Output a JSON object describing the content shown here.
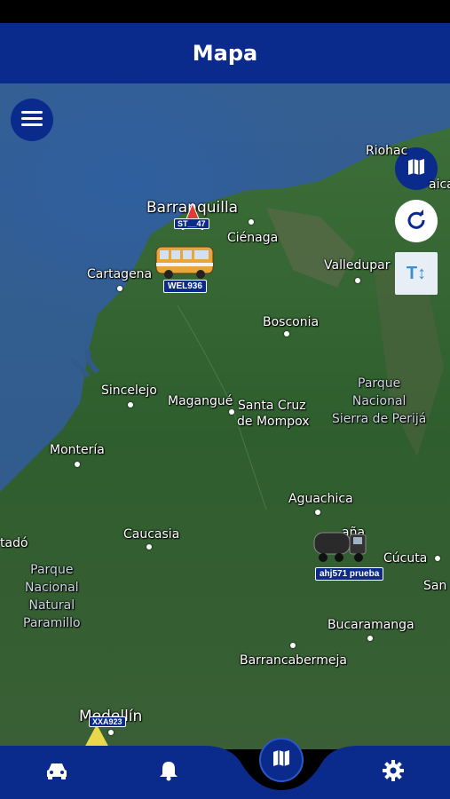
{
  "header": {
    "title": "Mapa"
  },
  "map": {
    "cities": [
      {
        "id": "barranquilla",
        "label": "Barranquilla",
        "big": true
      },
      {
        "id": "cienaga",
        "label": "Ciénaga"
      },
      {
        "id": "cartagena",
        "label": "Cartagena"
      },
      {
        "id": "valledupar",
        "label": "Valledupar"
      },
      {
        "id": "bosconia",
        "label": "Bosconia"
      },
      {
        "id": "sincelejo",
        "label": "Sincelejo"
      },
      {
        "id": "magangue",
        "label": "Magangué"
      },
      {
        "id": "santacruz1",
        "label": "Santa Cruz"
      },
      {
        "id": "santacruz2",
        "label": "de Mompox"
      },
      {
        "id": "monteria",
        "label": "Montería"
      },
      {
        "id": "aguachica",
        "label": "Aguachica"
      },
      {
        "id": "caucasia",
        "label": "Caucasia"
      },
      {
        "id": "cucuta",
        "label": "Cúcuta"
      },
      {
        "id": "bucaramanga",
        "label": "Bucaramanga"
      },
      {
        "id": "barrancabermeja",
        "label": "Barrancabermeja"
      },
      {
        "id": "medellin",
        "label": "Medellín",
        "big": true
      },
      {
        "id": "riohacha",
        "label": "Riohac"
      },
      {
        "id": "tado",
        "label": "tadó"
      },
      {
        "id": "san",
        "label": "San"
      },
      {
        "id": "ocana",
        "label": "aña"
      },
      {
        "id": "aica",
        "label": "aica"
      }
    ],
    "parks": [
      {
        "id": "perija",
        "lines": [
          "Parque",
          "Nacional",
          "Sierra de Perijá"
        ]
      },
      {
        "id": "paramillo",
        "lines": [
          "Parque",
          "Nacional",
          "Natural",
          "Paramillo"
        ]
      }
    ],
    "vehicles": [
      {
        "id": "bus",
        "plate": "WEL936",
        "icon": "bus-icon"
      },
      {
        "id": "arrow",
        "plate": "ST__47",
        "icon": "red-arrow-marker-icon"
      },
      {
        "id": "truck",
        "plate": "ahj571 prueba",
        "icon": "tanker-truck-icon"
      },
      {
        "id": "yellow",
        "plate": "XXA923",
        "icon": "yellow-arrow-marker-icon"
      }
    ],
    "controls": {
      "menu_icon": "hamburger-menu-icon",
      "layers_icon": "map-layers-icon",
      "refresh_icon": "refresh-icon",
      "text_toggle": "T↕"
    }
  },
  "bottom_nav": {
    "items": [
      {
        "id": "vehicles",
        "icon": "car-icon"
      },
      {
        "id": "alerts",
        "icon": "bell-icon"
      },
      {
        "id": "map",
        "icon": "map-icon",
        "active": true
      },
      {
        "id": "settings",
        "icon": "gear-icon"
      }
    ]
  },
  "colors": {
    "primary": "#0a2a8c",
    "header_bg": "#0a2a8c",
    "plate_bg": "#0a2a8c"
  }
}
